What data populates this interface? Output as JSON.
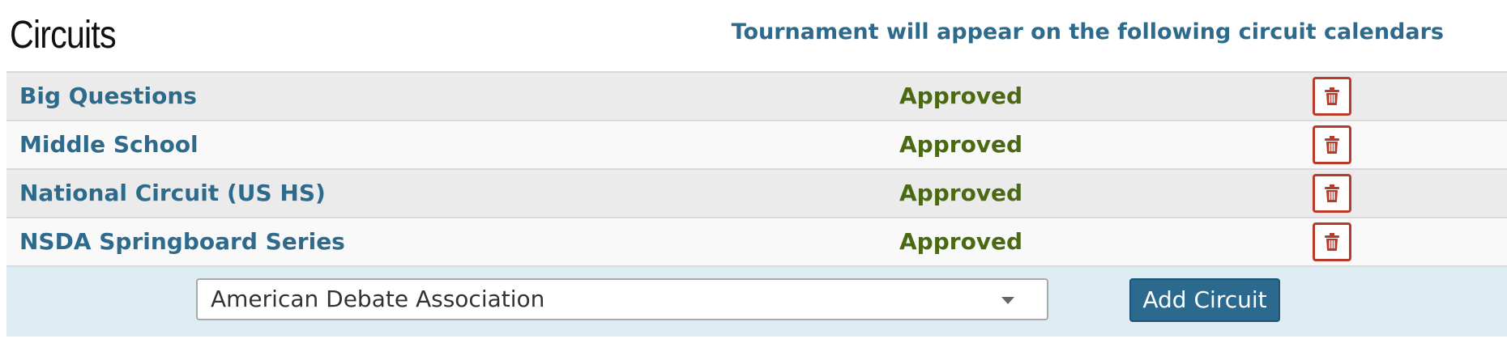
{
  "header": {
    "title": "Circuits",
    "subtitle": "Tournament will appear on the following circuit calendars"
  },
  "circuits": [
    {
      "name": "Big Questions",
      "status": "Approved",
      "delete_icon": "trash-icon"
    },
    {
      "name": "Middle School",
      "status": "Approved",
      "delete_icon": "trash-icon"
    },
    {
      "name": "National Circuit (US HS)",
      "status": "Approved",
      "delete_icon": "trash-icon"
    },
    {
      "name": "NSDA Springboard Series",
      "status": "Approved",
      "delete_icon": "trash-icon"
    }
  ],
  "add_form": {
    "selected_circuit": "American Debate Association",
    "add_button_label": "Add Circuit"
  },
  "colors": {
    "link": "#2d6a8c",
    "approved": "#4a6a12",
    "delete": "#b83a2a",
    "button": "#2b6a8e",
    "footer_bg": "#deecf4"
  }
}
